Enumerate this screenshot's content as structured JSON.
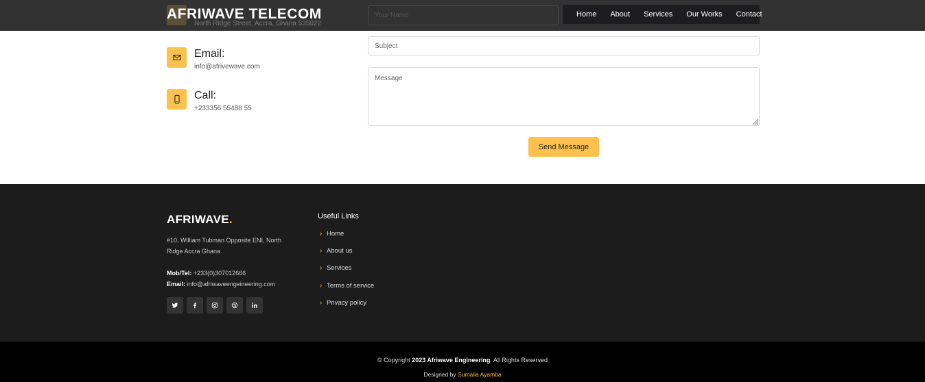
{
  "header": {
    "logo": "AFRIWAVE TELECOM",
    "partial_address": "North Ridge Street, Accra, Ghana 535022",
    "name_placeholder": "Your Name",
    "nav": [
      "Home",
      "About",
      "Services",
      "Our Works",
      "Contact"
    ]
  },
  "contact": {
    "email_title": "Email:",
    "email_value": "info@afrivewave.com",
    "call_title": "Call:",
    "call_value": "+233356 55488 55",
    "subject_placeholder": "Subject",
    "message_placeholder": "Message",
    "send_label": "Send Message"
  },
  "footer": {
    "brand": "AFRIWAVE",
    "brand_dot": ".",
    "address_line1": "#10, William Tubman Opposite ENI, North",
    "address_line2": "Ridge Accra Ghana",
    "phone_label": "Mob/Tel:",
    "phone_value": "+233(0)307012666",
    "email_label": "Email:",
    "email_value": "info@afriwaveengeineering.com",
    "socials": [
      "twitter-icon",
      "facebook-icon",
      "instagram-icon",
      "skype-icon",
      "linkedin-icon"
    ],
    "links_title": "Useful Links",
    "links": [
      "Home",
      "About us",
      "Services",
      "Terms of service",
      "Privacy policy"
    ]
  },
  "bottom": {
    "copy_prefix": "© Copyright",
    "copy_bold": "2023 Afriwave Engineering",
    "copy_suffix": ". All Rights Reserved",
    "designed_by": "Designed by",
    "designer": "Sumaila Ayamba"
  },
  "colors": {
    "accent": "#fcc24d",
    "header_bg": "#212121",
    "footer_bg": "#1c1c1c",
    "bottom_bg": "#000000"
  }
}
